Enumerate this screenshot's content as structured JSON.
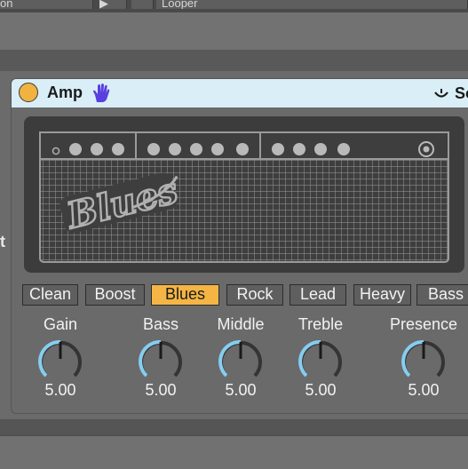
{
  "top": {
    "col1": "on",
    "col4": "Looper"
  },
  "left_label": "t",
  "device": {
    "title": "Amp",
    "right_label": "So",
    "amp_logo": "Blues",
    "presets": [
      {
        "label": "Clean",
        "selected": false
      },
      {
        "label": "Boost",
        "selected": false
      },
      {
        "label": "Blues",
        "selected": true
      },
      {
        "label": "Rock",
        "selected": false
      },
      {
        "label": "Lead",
        "selected": false
      },
      {
        "label": "Heavy",
        "selected": false
      },
      {
        "label": "Bass",
        "selected": false
      }
    ],
    "knobs": [
      {
        "label": "Gain",
        "value": "5.00"
      },
      {
        "label": "Bass",
        "value": "5.00"
      },
      {
        "label": "Middle",
        "value": "5.00"
      },
      {
        "label": "Treble",
        "value": "5.00"
      },
      {
        "label": "Presence",
        "value": "5.00"
      }
    ]
  },
  "colors": {
    "accent": "#f4b544",
    "knob_arc": "#86cdf0",
    "titlebar": "#d9eef7"
  }
}
